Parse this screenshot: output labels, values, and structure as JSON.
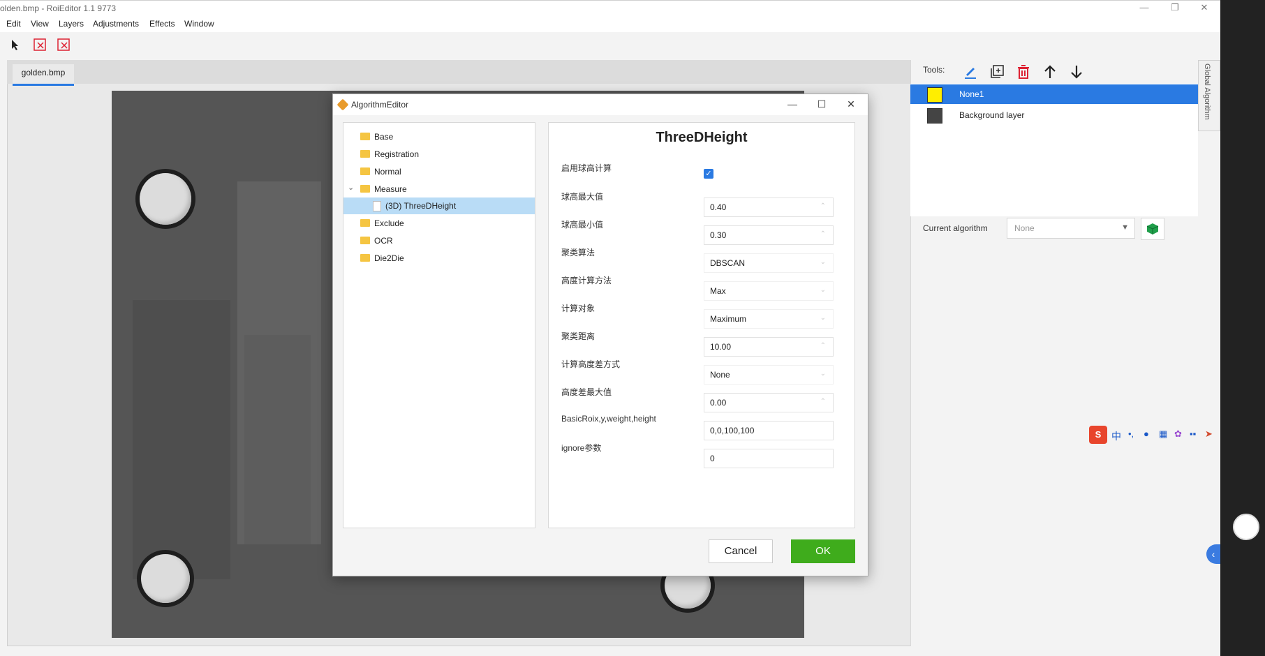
{
  "window": {
    "title": "olden.bmp - RoiEditor 1.1 9773",
    "minimize": "—",
    "maximize": "❐",
    "close": "✕"
  },
  "menu": [
    "Edit",
    "View",
    "Layers",
    "Adjustments",
    "Effects",
    "Window"
  ],
  "document_tab": "golden.bmp",
  "right_panel": {
    "tools_label": "Tools:",
    "layers": [
      {
        "name": "None1",
        "swatch": "#ffee00",
        "selected": true
      },
      {
        "name": "Background layer",
        "swatch": "#444444",
        "selected": false
      }
    ],
    "current_algorithm_label": "Current algorithm",
    "current_algorithm_value": "None",
    "global_tab": "Global Algorithm"
  },
  "dialog": {
    "title": "AlgorithmEditor",
    "tree": [
      {
        "label": "Base",
        "type": "folder"
      },
      {
        "label": "Registration",
        "type": "folder"
      },
      {
        "label": "Normal",
        "type": "folder"
      },
      {
        "label": "Measure",
        "type": "folder",
        "expanded": true
      },
      {
        "label": "(3D) ThreeDHeight",
        "type": "file",
        "selected": true
      },
      {
        "label": "Exclude",
        "type": "folder"
      },
      {
        "label": "OCR",
        "type": "folder"
      },
      {
        "label": "Die2Die",
        "type": "folder"
      }
    ],
    "props_title": "ThreeDHeight",
    "props": [
      {
        "label": "启用球高计算",
        "kind": "checkbox",
        "value": "✓"
      },
      {
        "label": "球高最大值",
        "kind": "number",
        "value": "0.40"
      },
      {
        "label": "球高最小值",
        "kind": "number",
        "value": "0.30"
      },
      {
        "label": "聚类算法",
        "kind": "select",
        "value": "DBSCAN"
      },
      {
        "label": "高度计算方法",
        "kind": "select",
        "value": "Max"
      },
      {
        "label": "计算对象",
        "kind": "select",
        "value": "Maximum"
      },
      {
        "label": "聚类距离",
        "kind": "number",
        "value": "10.00"
      },
      {
        "label": "计算高度差方式",
        "kind": "select",
        "value": "None"
      },
      {
        "label": "高度差最大值",
        "kind": "number",
        "value": "0.00"
      },
      {
        "label": "BasicRoix,y,weight,height",
        "kind": "text",
        "value": "0,0,100,100"
      },
      {
        "label": "ignore参数",
        "kind": "text",
        "value": "0"
      }
    ],
    "cancel_label": "Cancel",
    "ok_label": "OK"
  },
  "ime": {
    "label": "中"
  }
}
